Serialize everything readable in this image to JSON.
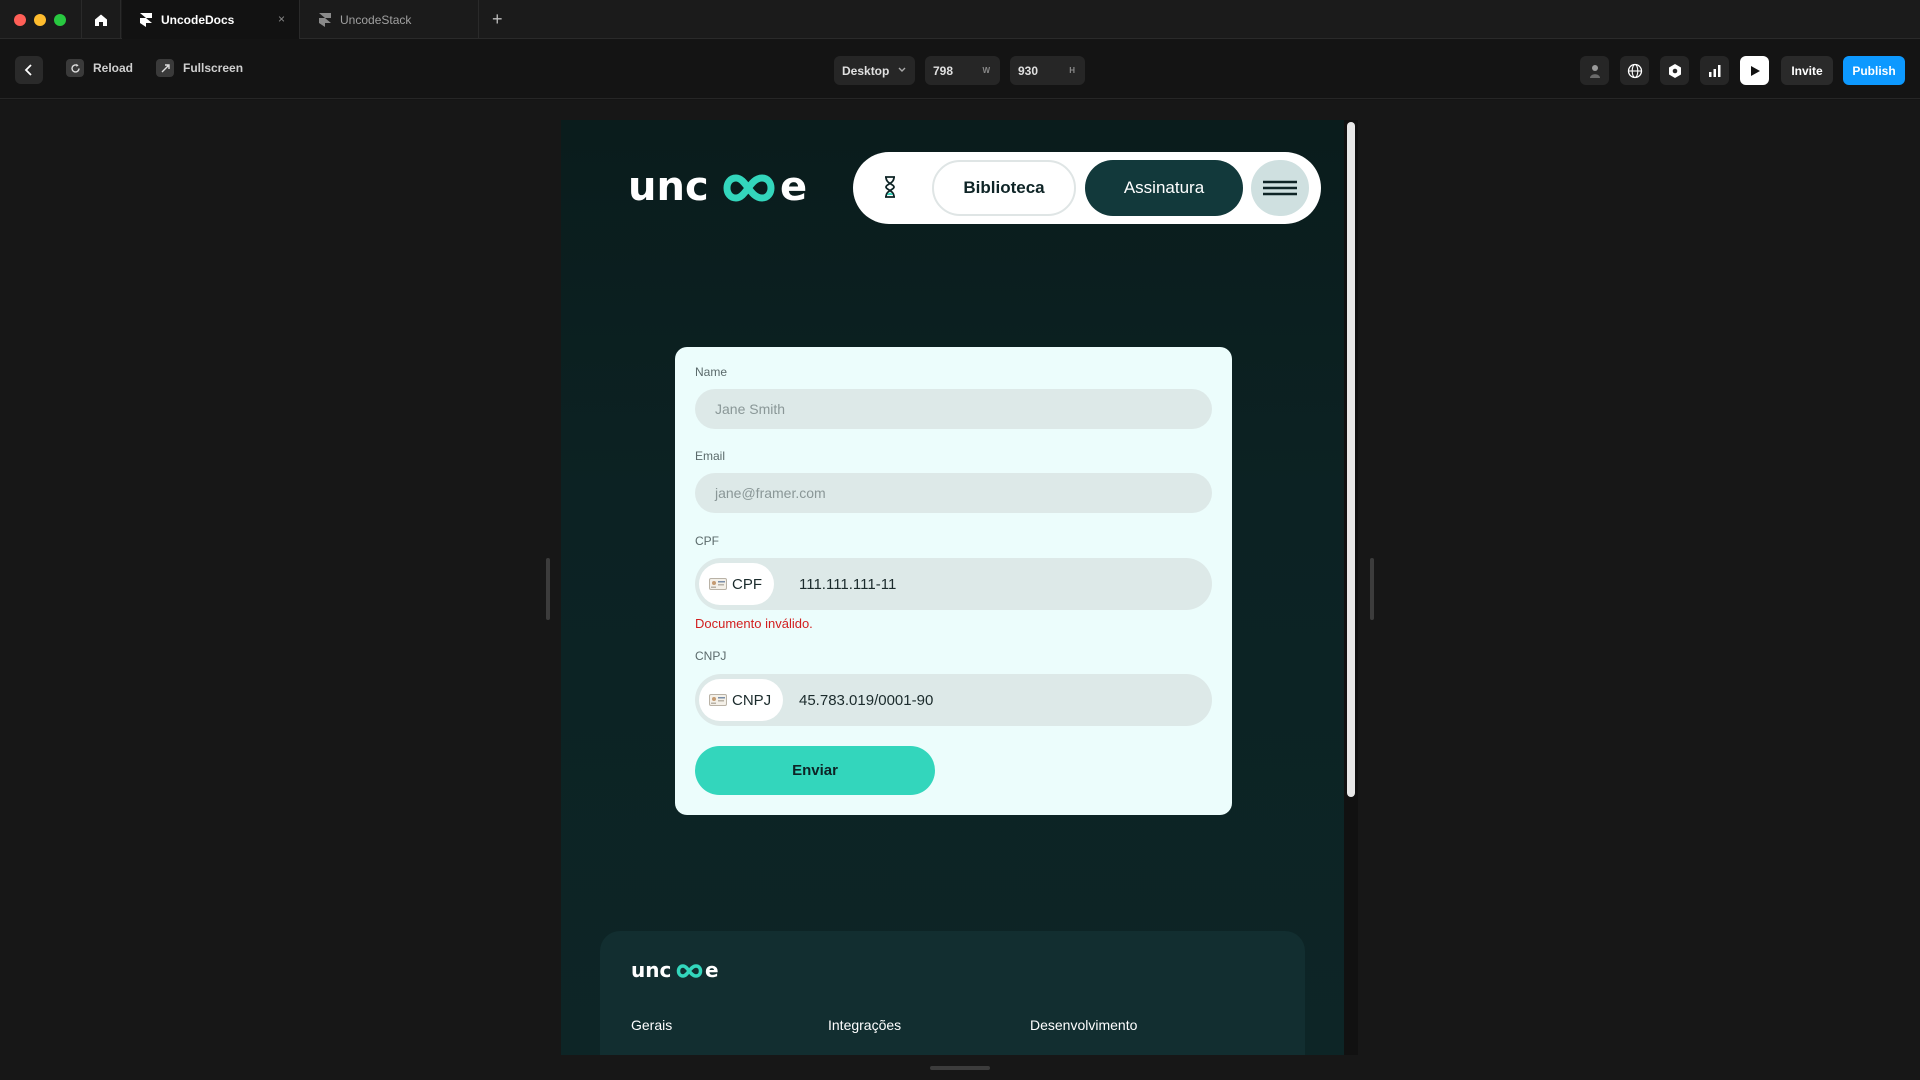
{
  "browser": {
    "tabs": [
      {
        "label": "UncodeDocs",
        "close": "×"
      },
      {
        "label": "UncodeStack"
      }
    ],
    "new_tab": "+",
    "traffic_colors": [
      "#ff5f57",
      "#febc2e",
      "#28c840"
    ]
  },
  "toolbar": {
    "reload_label": "Reload",
    "fullscreen_label": "Fullscreen",
    "device": "Desktop",
    "width": "798",
    "width_unit": "W",
    "height": "930",
    "height_unit": "H",
    "invite_label": "Invite",
    "publish_label": "Publish",
    "accent": "#0d99ff"
  },
  "site": {
    "logo_text_left": "unc",
    "logo_text_right": "e",
    "accent": "#33d6bc",
    "nav": {
      "library_label": "Biblioteca",
      "subscription_label": "Assinatura"
    },
    "form": {
      "name_label": "Name",
      "name_placeholder": "Jane Smith",
      "email_label": "Email",
      "email_placeholder": "jane@framer.com",
      "cpf_label": "CPF",
      "cpf_tag": "CPF",
      "cpf_value": "111.111.111-11",
      "cpf_error": "Documento inválido.",
      "cnpj_label": "CNPJ",
      "cnpj_tag": "CNPJ",
      "cnpj_value": "45.783.019/0001-90",
      "submit_label": "Enviar"
    },
    "footer": {
      "columns": [
        "Gerais",
        "Integrações",
        "Desenvolvimento"
      ]
    }
  }
}
